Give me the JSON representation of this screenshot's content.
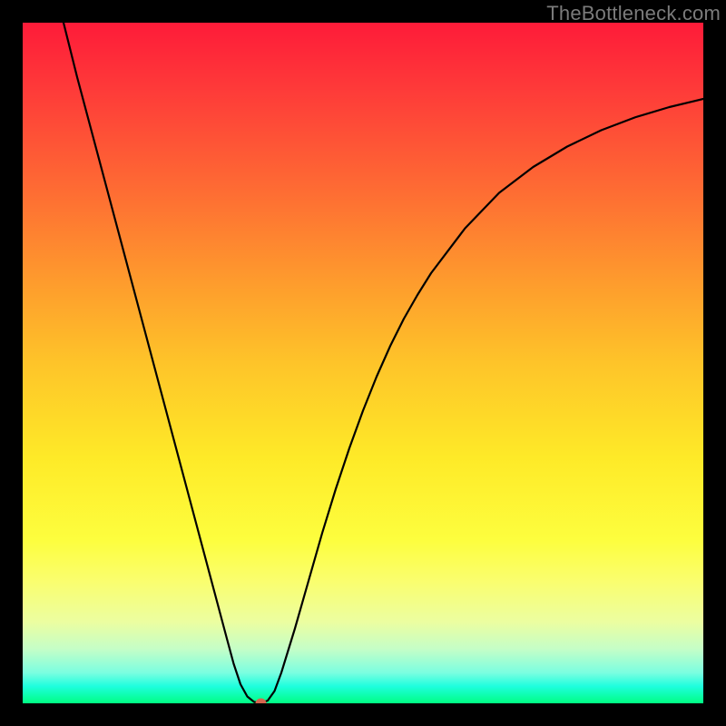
{
  "watermark": "TheBottleneck.com",
  "chart_data": {
    "type": "line",
    "title": "",
    "xlabel": "",
    "ylabel": "",
    "xlim": [
      0,
      100
    ],
    "ylim": [
      0,
      100
    ],
    "series": [
      {
        "name": "curve",
        "x": [
          6,
          8,
          10,
          12,
          14,
          16,
          18,
          20,
          22,
          24,
          26,
          28,
          30,
          31,
          32,
          33,
          34,
          35,
          36,
          37,
          38,
          40,
          42,
          44,
          46,
          48,
          50,
          52,
          54,
          56,
          58,
          60,
          65,
          70,
          75,
          80,
          85,
          90,
          95,
          100
        ],
        "y": [
          100,
          92,
          84.5,
          77,
          69.5,
          62,
          54.5,
          47,
          39.5,
          32,
          24.5,
          17,
          9.5,
          5.8,
          2.8,
          1.0,
          0.2,
          0.0,
          0.4,
          1.8,
          4.5,
          11,
          18,
          25,
          31.5,
          37.5,
          43,
          48,
          52.5,
          56.5,
          60,
          63.2,
          69.8,
          75,
          78.8,
          81.8,
          84.2,
          86.1,
          87.6,
          88.8
        ]
      }
    ],
    "marker": {
      "x": 35,
      "y": 0,
      "color": "#d6664f"
    }
  }
}
